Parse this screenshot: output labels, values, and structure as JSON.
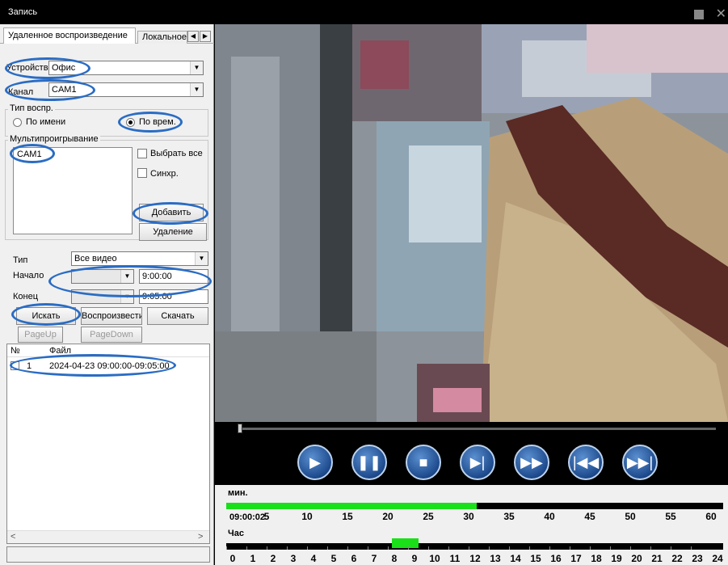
{
  "window": {
    "title": "Запись"
  },
  "tabs": [
    "Удаленное воспроизведение",
    "Локальное"
  ],
  "device": {
    "label": "Устройство",
    "value": "Офис"
  },
  "channel": {
    "label": "Канал",
    "value": "CAM1"
  },
  "play_type": {
    "title": "Тип воспр.",
    "by_name": "По имени",
    "by_time": "По врем.",
    "selected": "by_time"
  },
  "multiplay": {
    "title": "Мультипроигрывание",
    "items": [
      "CAM1"
    ],
    "select_all": "Выбрать все",
    "sync": "Синхр.",
    "add": "Добавить",
    "remove": "Удаление"
  },
  "filter": {
    "type_label": "Тип",
    "type_value": "Все видео",
    "start_label": "Начало",
    "start_time": "9:00:00",
    "end_label": "Конец",
    "end_time": "9:05:00"
  },
  "actions": {
    "search": "Искать",
    "play": "Воспроизвести",
    "download": "Скачать",
    "page_up": "PageUp",
    "page_down": "PageDown"
  },
  "files": {
    "col_no": "№",
    "col_file": "Файл",
    "rows": [
      {
        "no": "1",
        "file": "2024-04-23 09:00:00-09:05:00"
      }
    ]
  },
  "timeline": {
    "min_label": "мин.",
    "hour_label": "Час",
    "current_time": "09:00:02",
    "minute_ticks": [
      "0",
      "5",
      "10",
      "15",
      "20",
      "25",
      "30",
      "35",
      "40",
      "45",
      "50",
      "55",
      "60"
    ],
    "hour_ticks": [
      "0",
      "1",
      "2",
      "3",
      "4",
      "5",
      "6",
      "7",
      "8",
      "9",
      "10",
      "11",
      "12",
      "13",
      "14",
      "15",
      "16",
      "17",
      "18",
      "19",
      "20",
      "21",
      "22",
      "23",
      "24"
    ],
    "minute_recorded": [
      0,
      31
    ],
    "hour_recorded": [
      9,
      10
    ]
  }
}
